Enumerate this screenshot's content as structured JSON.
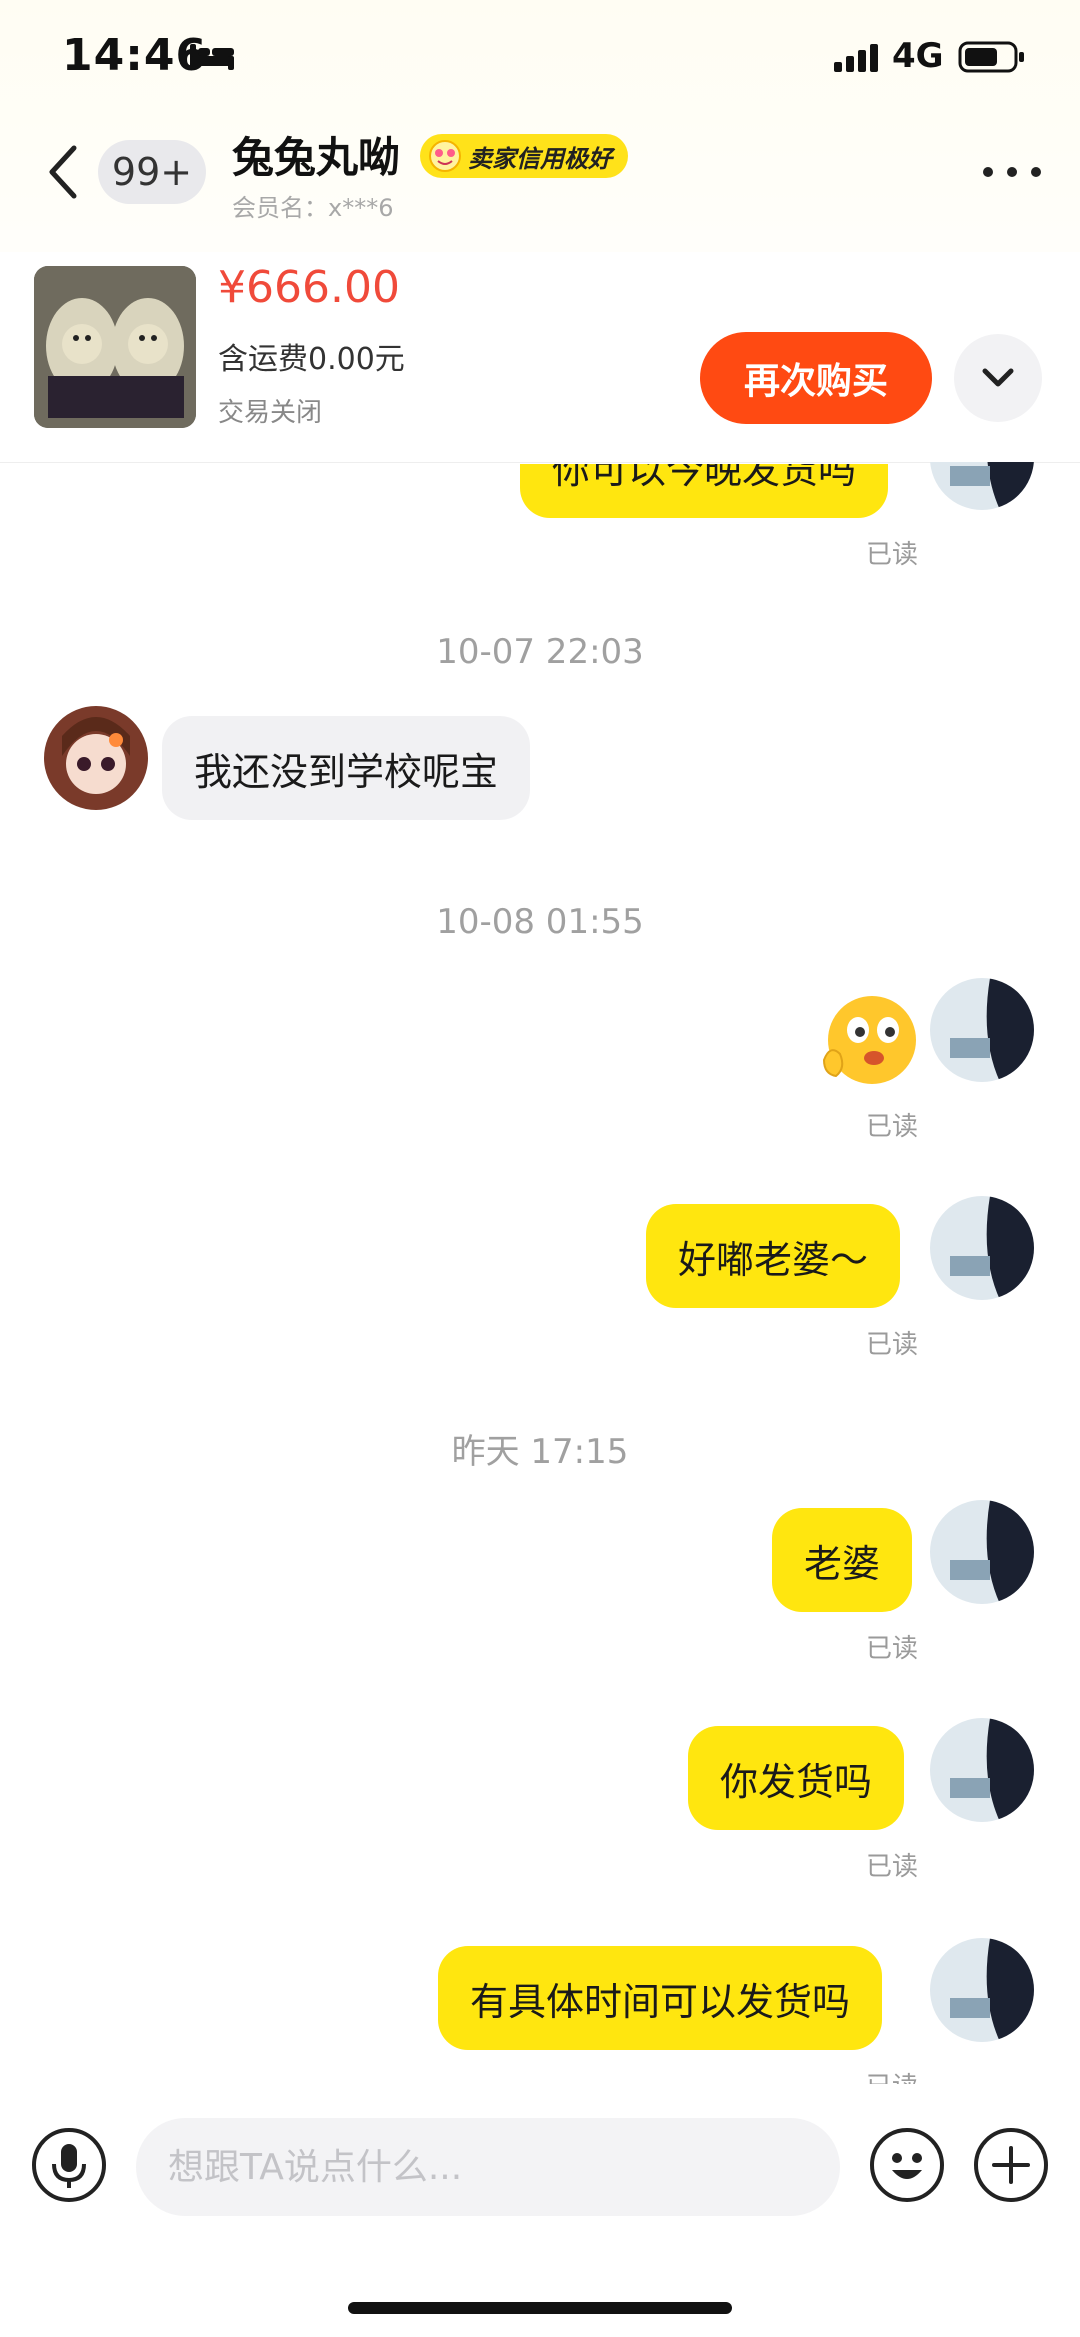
{
  "status_bar": {
    "time": "14:46",
    "network": "4G"
  },
  "header": {
    "unread_count": "99+",
    "shop_name": "兔兔丸呦",
    "credit_badge": "卖家信用极好",
    "member_name": "会员名：x***6"
  },
  "product": {
    "price": "¥666.00",
    "shipping": "含运费0.00元",
    "status": "交易关闭",
    "rebuy_label": "再次购买"
  },
  "messages": [
    {
      "type": "text",
      "from": "me",
      "text": "你可以今晚发货吗",
      "read": "已读"
    },
    {
      "type": "timestamp",
      "text": "10-07 22:03"
    },
    {
      "type": "text",
      "from": "them",
      "text": "我还没到学校呢宝"
    },
    {
      "type": "timestamp",
      "text": "10-08 01:55"
    },
    {
      "type": "sticker",
      "from": "me",
      "read": "已读"
    },
    {
      "type": "text",
      "from": "me",
      "text": "好嘟老婆～",
      "read": "已读"
    },
    {
      "type": "timestamp",
      "text": "昨天 17:15"
    },
    {
      "type": "text",
      "from": "me",
      "text": "老婆",
      "read": "已读"
    },
    {
      "type": "text",
      "from": "me",
      "text": "你发货吗",
      "read": "已读"
    },
    {
      "type": "text",
      "from": "me",
      "text": "有具体时间可以发货吗",
      "read": "已读"
    }
  ],
  "composer": {
    "placeholder": "想跟TA说点什么..."
  },
  "colors": {
    "bubble_mine": "#ffe60f",
    "price": "#f04a3a",
    "rebuy": "#ff4a12",
    "credit_badge": "#ffe21a"
  }
}
